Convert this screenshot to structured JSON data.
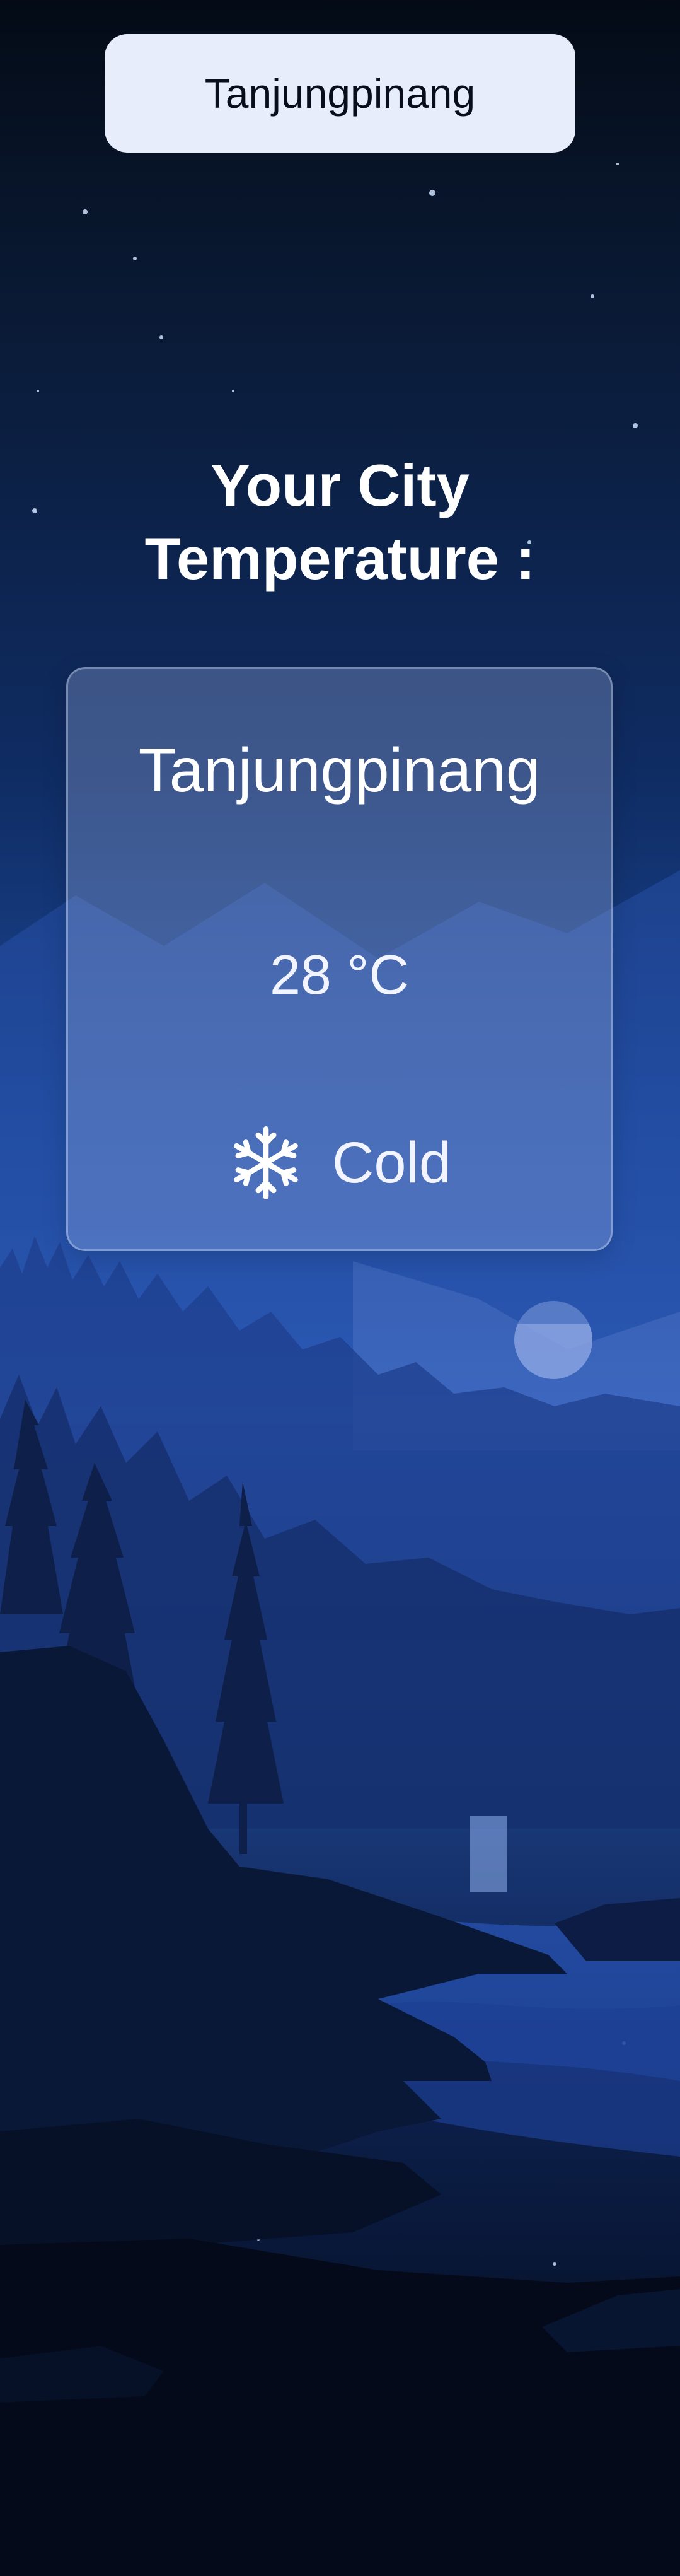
{
  "search": {
    "value": "Tanjungpinang"
  },
  "heading": {
    "line1": "Your City",
    "line2": "Temperature :"
  },
  "weather": {
    "city": "Tanjungpinang",
    "temperature": "28 °C",
    "condition": "Cold",
    "condition_icon": "snowflake-icon"
  },
  "colors": {
    "search_bg": "#e8edfc",
    "card_bg": "rgba(170,190,240,0.30)",
    "text": "#ffffff"
  }
}
